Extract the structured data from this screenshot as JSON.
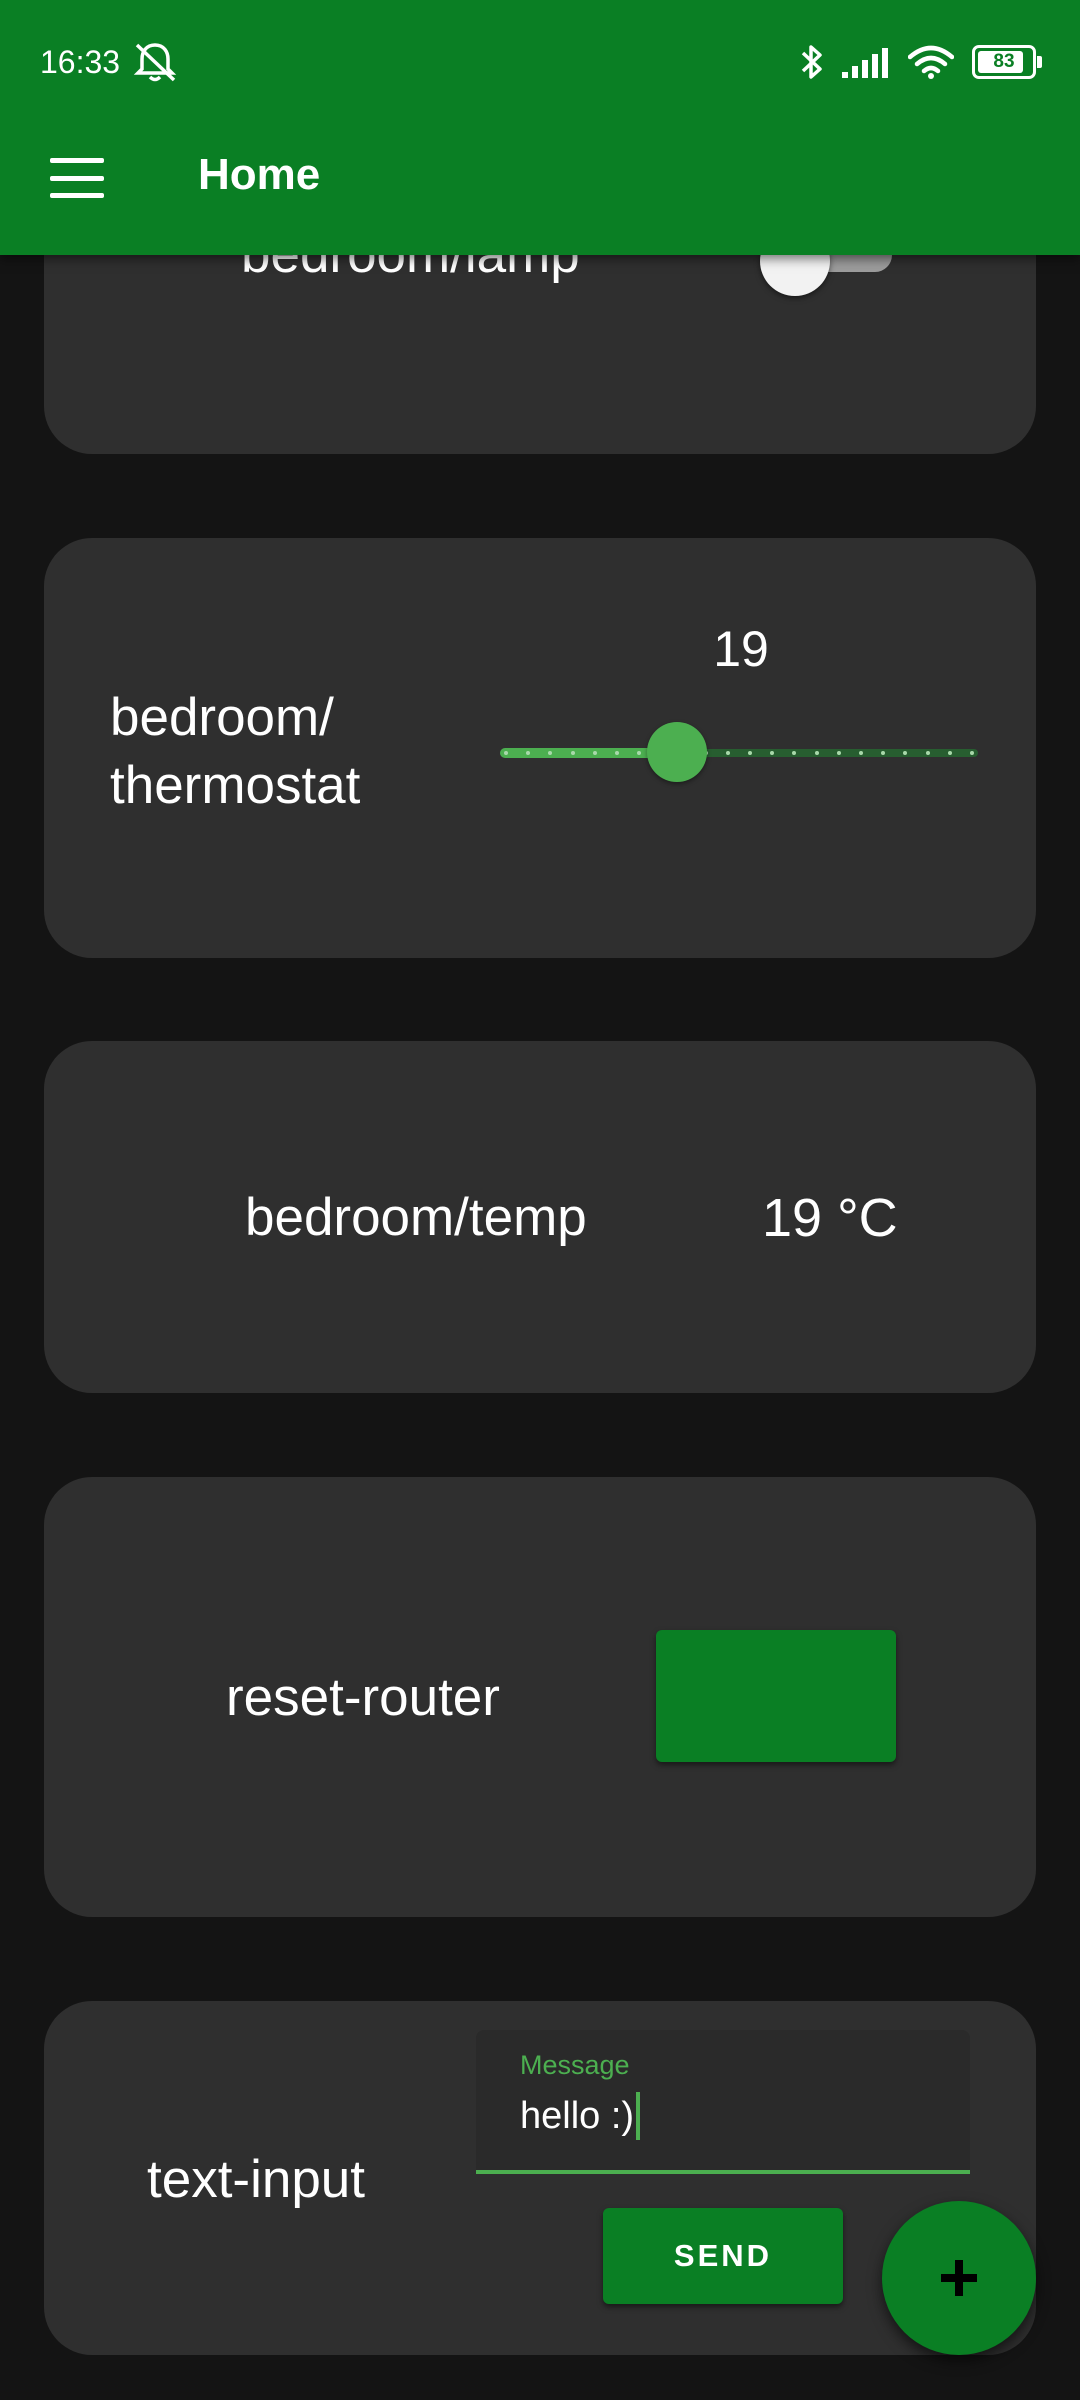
{
  "status_bar": {
    "time": "16:33",
    "battery": "83",
    "icons": [
      "bell-off-icon",
      "bluetooth-icon",
      "signal-icon",
      "wifi-icon",
      "battery-icon"
    ]
  },
  "app_bar": {
    "title": "Home",
    "menu_icon": "menu-icon",
    "color": "#0a7f24"
  },
  "cards": {
    "lamp": {
      "label": "bedroom/lamp",
      "switch_on": false
    },
    "thermostat": {
      "label_line1": "bedroom/",
      "label_line2": "thermostat",
      "value": "19",
      "level": 0.37
    },
    "temp": {
      "label": "bedroom/temp",
      "value": "19 °C"
    },
    "reset": {
      "label": "reset-router",
      "button_label": ""
    },
    "text_input": {
      "label": "text-input",
      "field_label": "Message",
      "field_value": "hello :)",
      "send_label": "SEND"
    }
  },
  "fab": {
    "icon": "plus-icon"
  },
  "colors": {
    "accent": "#4caf50",
    "primary": "#0a7f24",
    "card": "#2f2f2f",
    "background": "#141414"
  }
}
